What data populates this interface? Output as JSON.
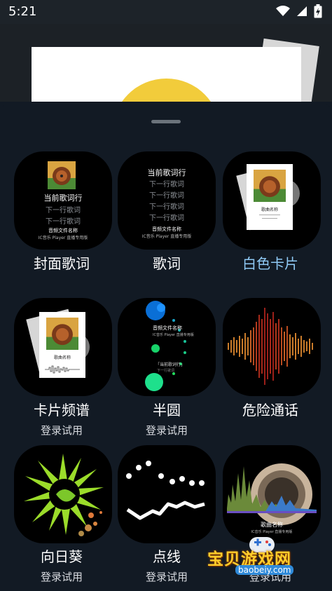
{
  "status_bar": {
    "time": "5:21"
  },
  "grid": {
    "items": [
      {
        "label": "封面歌词",
        "sub": ""
      },
      {
        "label": "歌词",
        "sub": ""
      },
      {
        "label": "白色卡片",
        "sub": ""
      },
      {
        "label": "卡片频谱",
        "sub": "登录试用"
      },
      {
        "label": "半圆",
        "sub": "登录试用"
      },
      {
        "label": "危险通话",
        "sub": ""
      },
      {
        "label": "向日葵",
        "sub": "登录试用"
      },
      {
        "label": "点线",
        "sub": "登录试用"
      },
      {
        "label": "",
        "sub": "登录试用"
      }
    ]
  },
  "previews": {
    "cover_lyrics": {
      "current": "当前歌词行",
      "next": "下一行歌词",
      "file": "音频文件名称",
      "sub": "IC音乐 Player 直播专用版"
    },
    "lyrics": {
      "current": "当前歌词行",
      "next": "下一行歌词",
      "file": "音频文件名称",
      "sub": "IC音乐 Player 直播专用版"
    },
    "semicircle": {
      "file": "音频文件名称",
      "sub": "IC音乐 Player 直播专用版",
      "lyric": "「当前歌词行」",
      "next": "下一行歌词"
    },
    "card_title": "歌曲名称",
    "spectrum": {
      "title": "歌曲名称",
      "sub": "IC音乐 Player 直播专用版"
    }
  },
  "watermark": {
    "text": "宝贝游戏网",
    "url": "baobeiy.com"
  },
  "colors": {
    "accent": "#8fc9f5",
    "background": "#121a24",
    "tile": "#000000"
  }
}
